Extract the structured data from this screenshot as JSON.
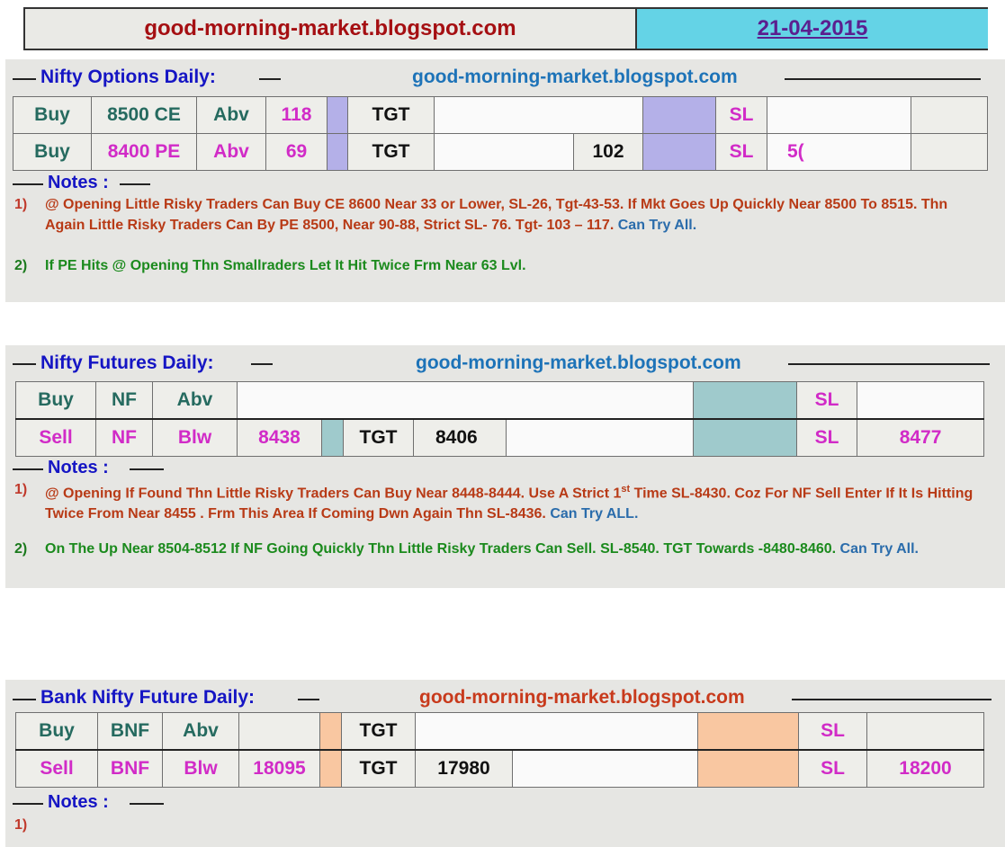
{
  "header": {
    "site": "good-morning-market.blogspot.com",
    "date": "21-04-2015"
  },
  "options": {
    "title": "Nifty  Options  Daily:",
    "site": "good-morning-market.blogspot.com",
    "rows": [
      {
        "action": "Buy",
        "instrument": "8500 CE",
        "cond": "Abv",
        "price": "118",
        "tgt_label": "TGT",
        "tgt1": "",
        "tgt2": "",
        "sl_label": "SL",
        "sl": ""
      },
      {
        "action": "Buy",
        "instrument": "8400 PE",
        "cond": "Abv",
        "price": "69",
        "tgt_label": "TGT",
        "tgt1": "",
        "tgt2": "102",
        "sl_label": "SL",
        "sl": "5("
      }
    ],
    "notes_label": "Notes :",
    "notes": [
      {
        "num": "1)",
        "text": "@ Opening Little Risky Traders  Can Buy CE 8600  Near 33 or Lower, SL-26, Tgt-43-53.  If Mkt Goes Up Quickly Near 8500 To 8515. Thn Again Little Risky Traders Can By PE 8500, Near 90-88, Strict SL- 76. Tgt- 103 – 117.",
        "tail": "Can Try All."
      },
      {
        "num": "2)",
        "text": "If PE Hits @ Opening Thn Smallraders Let It Hit Twice Frm Near 63 Lvl."
      }
    ]
  },
  "futures": {
    "title": "Nifty Futures  Daily:",
    "site": "good-morning-market.blogspot.com",
    "rows": [
      {
        "action": "Buy",
        "instrument": "NF",
        "cond": "Abv",
        "price": "",
        "tgt_label": "",
        "tgt": "",
        "sl_label": "SL",
        "sl": ""
      },
      {
        "action": "Sell",
        "instrument": "NF",
        "cond": "Blw",
        "price": "8438",
        "tgt_label": "TGT",
        "tgt": "8406",
        "sl_label": "SL",
        "sl": "8477"
      }
    ],
    "notes_label": "Notes :",
    "notes": [
      {
        "num": "1)",
        "text_a": "@ Opening If Found Thn Little Risky Traders Can Buy Near 8448-8444. Use A Strict 1",
        "sup": "st",
        "text_b": " Time SL-8430. Coz  For NF Sell Enter If It Is Hitting Twice From Near 8455 . Frm  This Area If Coming Dwn  Again Thn SL-8436.",
        "tail": "Can Try ALL."
      },
      {
        "num": "2)",
        "text": "On The Up Near 8504-8512  If NF Going Quickly Thn Little Risky Traders Can Sell. SL-8540. TGT Towards -8480-8460.",
        "tail": "Can Try All."
      }
    ]
  },
  "bank": {
    "title": "Bank Nifty Future  Daily:",
    "site": "good-morning-market.blogspot.com",
    "rows": [
      {
        "action": "Buy",
        "instrument": "BNF",
        "cond": "Abv",
        "price": "",
        "tgt_label": "TGT",
        "tgt": "",
        "sl_label": "SL",
        "sl": ""
      },
      {
        "action": "Sell",
        "instrument": "BNF",
        "cond": "Blw",
        "price": "18095",
        "tgt_label": "TGT",
        "tgt": "17980",
        "sl_label": "SL",
        "sl": "18200"
      }
    ],
    "notes_label": "Notes :",
    "notes": [
      {
        "num": "1)"
      }
    ]
  }
}
